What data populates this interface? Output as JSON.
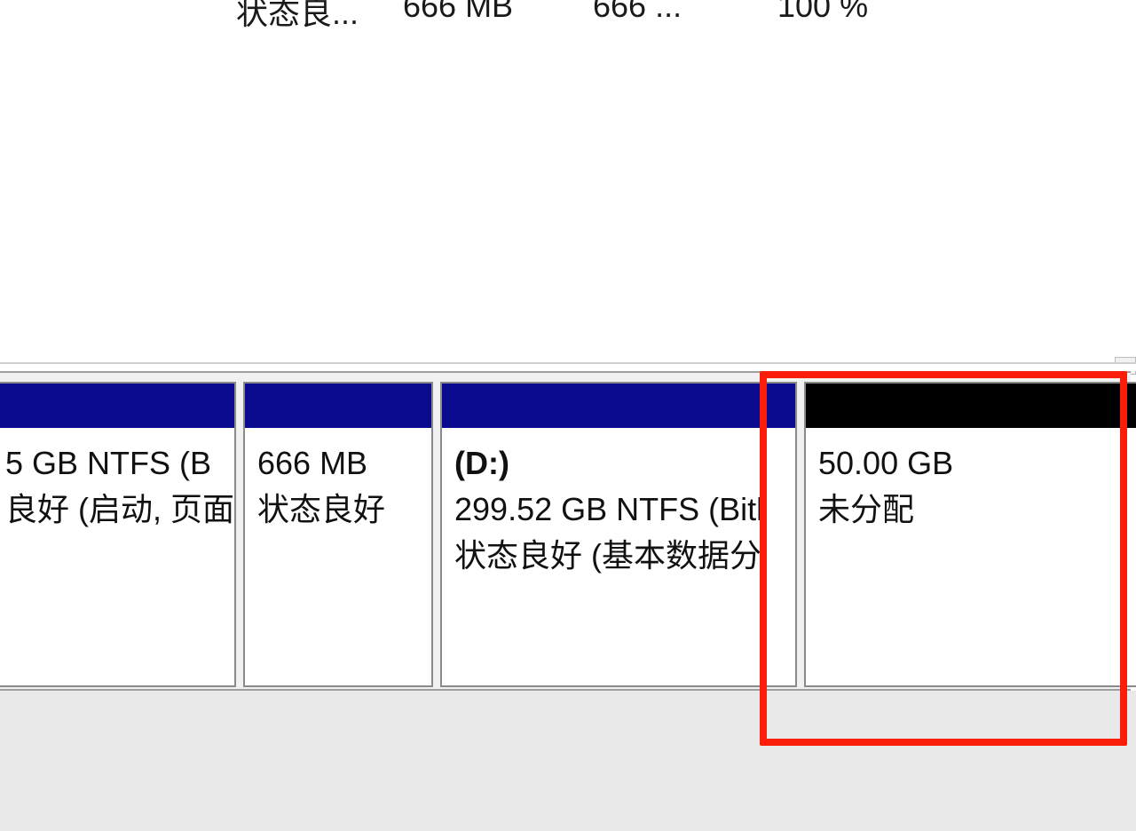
{
  "colors": {
    "primary_header": "#0b0b8f",
    "unallocated_header": "#000000",
    "highlight": "#fa1e0a"
  },
  "volume_list": {
    "rows": [
      {
        "status": "状态良...",
        "capacity": "666 MB",
        "free": "666 ...",
        "pct_free": "100 %"
      }
    ]
  },
  "disk_layout": {
    "partitions": [
      {
        "label": "",
        "line1": "5 GB NTFS (B",
        "line2": "良好 (启动, 页面",
        "type": "primary"
      },
      {
        "label": "",
        "line1": "666 MB",
        "line2": "状态良好",
        "type": "primary"
      },
      {
        "label": "(D:)",
        "line1": "299.52 GB NTFS (Bitl",
        "line2": "状态良好 (基本数据分",
        "type": "primary"
      },
      {
        "label": "",
        "line1": "50.00 GB",
        "line2": "未分配",
        "type": "unallocated"
      }
    ]
  }
}
